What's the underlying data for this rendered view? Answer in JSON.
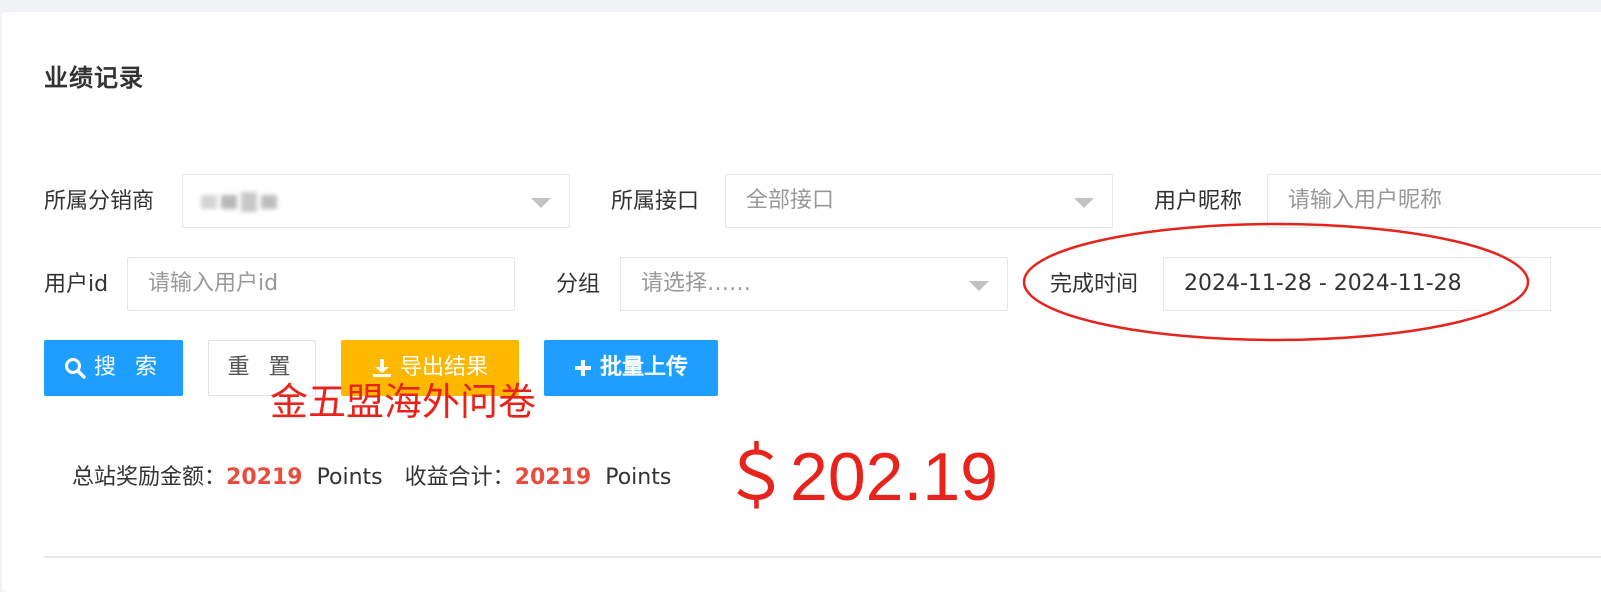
{
  "page": {
    "title": "业绩记录"
  },
  "filters": {
    "distributor": {
      "label": "所属分销商",
      "value": ""
    },
    "interface": {
      "label": "所属接口",
      "value": "全部接口"
    },
    "nickname": {
      "label": "用户昵称",
      "placeholder": "请输入用户昵称"
    },
    "user_id": {
      "label": "用户id",
      "placeholder": "请输入用户id"
    },
    "group": {
      "label": "分组",
      "placeholder": "请选择……"
    },
    "completion_time": {
      "label": "完成时间",
      "value": "2024-11-28 - 2024-11-28"
    }
  },
  "buttons": {
    "search": "搜 索",
    "reset": "重 置",
    "export": "导出结果",
    "upload": "批量上传"
  },
  "annotation": {
    "note": "金五盟海外问卷",
    "amount": "＄202.19",
    "color": "#e8231c"
  },
  "summary": {
    "total_label": "总站奖励金额：",
    "total_value": "20219",
    "total_unit": "Points",
    "income_label": "收益合计：",
    "income_value": "20219",
    "income_unit": "Points"
  },
  "colors": {
    "primary": "#1e9fff",
    "warning": "#ffb800",
    "highlight_number": "#e74c3c"
  },
  "icons": {
    "search": "search-icon",
    "export": "download-icon",
    "upload": "plus-icon",
    "dropdown": "caret-down-icon"
  }
}
